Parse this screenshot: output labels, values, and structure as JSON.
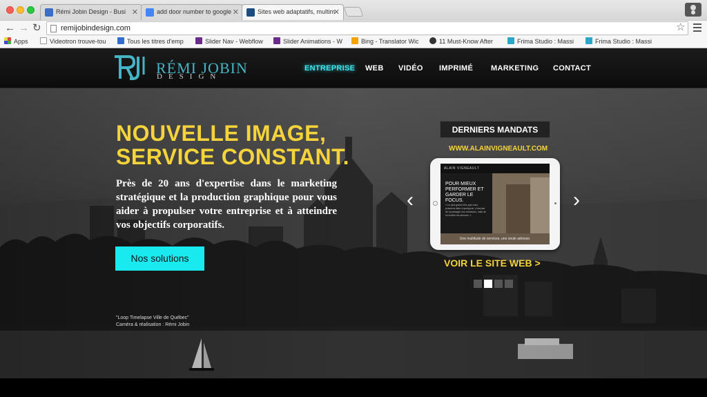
{
  "browser": {
    "tabs": [
      {
        "title": "Rémi Jobin Design - Busi",
        "active": false,
        "favicon_color": "#3a6ec9"
      },
      {
        "title": "add door number to google",
        "active": false,
        "favicon_color": "#4285f4"
      },
      {
        "title": "Sites web adaptatifs, multim",
        "active": true,
        "favicon_color": "#1c4d80"
      }
    ],
    "url": "remijobindesign.com",
    "bookmarks": [
      {
        "label": "Apps",
        "color": "#d44"
      },
      {
        "label": "Videotron trouve-tou",
        "color": "#999"
      },
      {
        "label": "Tous les titres d'emp",
        "color": "#2d6fcf"
      },
      {
        "label": "Slider Nav - Webflow",
        "color": "#6a2b8a"
      },
      {
        "label": "Slider Animations - W",
        "color": "#6a2b8a"
      },
      {
        "label": "Bing - Translator Wic",
        "color": "#f4a300"
      },
      {
        "label": "11 Must-Know After",
        "color": "#333"
      },
      {
        "label": "Frima Studio : Massi",
        "color": "#2aa7c9"
      },
      {
        "label": "Frima Studio : Massi",
        "color": "#2aa7c9"
      }
    ]
  },
  "site": {
    "logo": {
      "name": "RÉMI JOBIN",
      "sub": "DESIGN"
    },
    "nav": [
      {
        "label": "ENTREPRISE",
        "active": true
      },
      {
        "label": "WEB",
        "active": false
      },
      {
        "label": "VIDÉO",
        "active": false
      },
      {
        "label": "IMPRIMÉ",
        "active": false
      },
      {
        "label": "MARKETING",
        "active": false
      },
      {
        "label": "CONTACT",
        "active": false
      }
    ],
    "hero": {
      "headline_line1": "NOUVELLE IMAGE,",
      "headline_line2": "SERVICE CONSTANT.",
      "intro": "Près de 20 ans d'expertise dans le marketing stratégique et la production graphique pour vous aider à propulser votre entreprise et à atteindre vos objectifs corporatifs.",
      "cta_label": "Nos solutions",
      "credit_line1": "\"Loop Timelapse Ville de Québec\"",
      "credit_line2": "Caméra & réalisation : Rémi Jobin"
    },
    "mandats": {
      "title": "DERNIERS MANDATS",
      "url": "WWW.ALAINVIGNEAULT.COM",
      "screen_brand": "ALAIN VIGNEAULT",
      "screen_headline": "POUR MIEUX PERFORMER ET GARDER LE FOCUS.",
      "screen_quote": "« Le plus grand bien que nous puissions faire à quelqu'un, n'est pas de lui partager nos richesses, mais de lui révéler les siennes. »",
      "screen_footer": "Une multitude de services, une seule adresse.",
      "link_label": "VOIR LE SITE WEB >",
      "dots_total": 4,
      "dots_active_index": 1
    },
    "colors": {
      "accent_yellow": "#f5d33b",
      "accent_cyan": "#19eaf0",
      "logo_teal": "#45b5c5"
    }
  }
}
